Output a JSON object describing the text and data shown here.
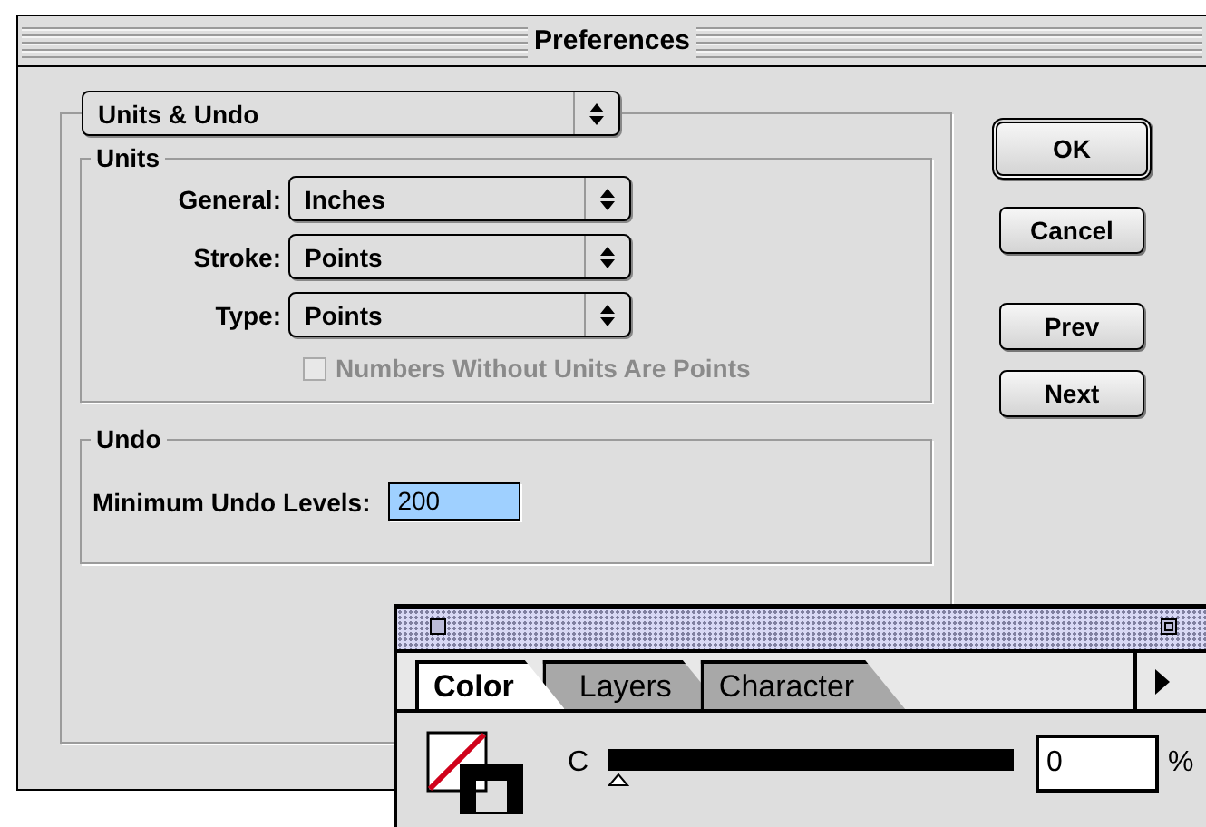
{
  "window": {
    "title": "Preferences"
  },
  "section_menu": {
    "value": "Units & Undo"
  },
  "units": {
    "title": "Units",
    "fields": [
      {
        "label": "General:",
        "value": "Inches"
      },
      {
        "label": "Stroke:",
        "value": "Points"
      },
      {
        "label": "Type:",
        "value": "Points"
      }
    ],
    "checkbox": {
      "label": "Numbers Without Units Are Points",
      "checked": false,
      "disabled": true
    }
  },
  "undo": {
    "title": "Undo",
    "label": "Minimum Undo Levels:",
    "value": "200",
    "text_selected": true
  },
  "buttons": [
    {
      "label": "OK",
      "default": true
    },
    {
      "label": "Cancel",
      "default": false
    },
    {
      "label": "Prev",
      "default": false
    },
    {
      "label": "Next",
      "default": false
    }
  ],
  "palette": {
    "tabs": [
      {
        "label": "Color",
        "selected": true
      },
      {
        "label": "Layers",
        "selected": false
      },
      {
        "label": "Character",
        "selected": false
      }
    ],
    "sliders": [
      {
        "label": "C",
        "level": 0,
        "value": "0",
        "unit": "%"
      }
    ]
  }
}
